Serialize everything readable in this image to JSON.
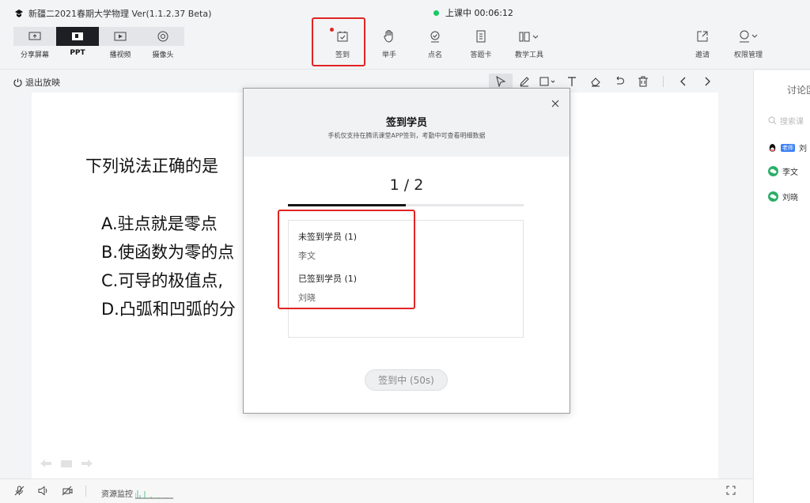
{
  "app": {
    "title": "新疆二2021春期大学物理 Ver(1.1.2.37 Beta)",
    "live_status": "上课中 00:06:12"
  },
  "modes": [
    {
      "label": "分享屏幕",
      "icon": "share-screen-icon",
      "active": false
    },
    {
      "label": "PPT",
      "icon": "ppt-icon",
      "active": true
    },
    {
      "label": "播视频",
      "icon": "play-video-icon",
      "active": false
    },
    {
      "label": "摄像头",
      "icon": "camera-icon",
      "active": false
    }
  ],
  "tools": {
    "signin": "签到",
    "raise_hand": "举手",
    "roll_call": "点名",
    "answer_card": "答题卡",
    "teaching_tools": "教学工具",
    "invite": "邀请",
    "permissions": "权限管理"
  },
  "toolbar": {
    "exit_play": "退出放映"
  },
  "slide": {
    "question": "下列说法正确的是",
    "options": [
      "A.驻点就是零点",
      "B.使函数为零的点",
      "C.可导的极值点,",
      "D.凸弧和凹弧的分"
    ]
  },
  "bottom": {
    "resource_monitor": "资源监控"
  },
  "right_panel": {
    "title": "讨论区",
    "search_placeholder": "搜索课",
    "teacher_tag": "老师",
    "users": [
      {
        "name": "刘",
        "role": "teacher"
      },
      {
        "name": "李文",
        "role": "student"
      },
      {
        "name": "刘晓",
        "role": "student"
      }
    ]
  },
  "modal": {
    "title": "签到学员",
    "subtitle": "手机仅支持在腾讯课堂APP签到，考勤中可查看明细数据",
    "progress_text": "1 / 2",
    "progress_ratio": 0.5,
    "not_signed_header": "未签到学员  (1)",
    "not_signed": [
      "李文"
    ],
    "signed_header": "已签到学员  (1)",
    "signed": [
      "刘晓"
    ],
    "button_label": "签到中 (50s)"
  },
  "colors": {
    "highlight_red": "#e02424",
    "live_green": "#17c964",
    "wechat_green": "#2aae67",
    "teacher_blue": "#3b7ff5"
  }
}
